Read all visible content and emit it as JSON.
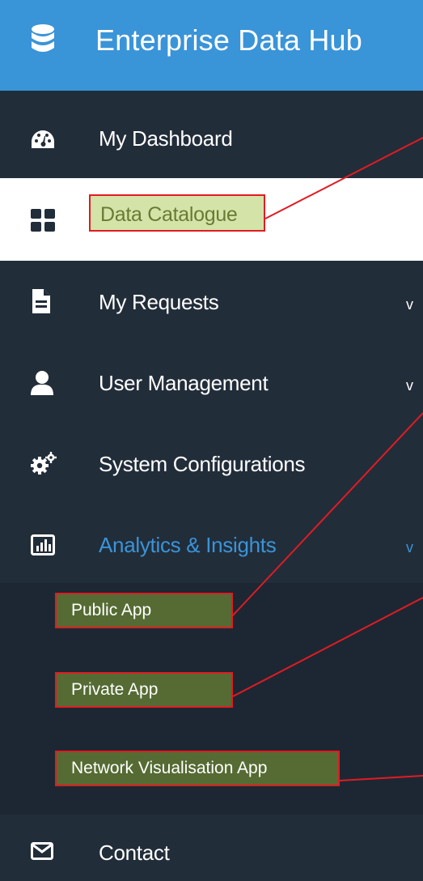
{
  "header": {
    "title": "Enterprise Data Hub",
    "logo_icon": "database-icon"
  },
  "nav": {
    "dashboard": {
      "label": "My Dashboard",
      "icon": "dashboard-icon"
    },
    "catalogue": {
      "label": "Data Catalogue",
      "icon": "grid-icon"
    },
    "requests": {
      "label": "My Requests",
      "icon": "document-icon",
      "chevron": "v"
    },
    "users": {
      "label": "User Management",
      "icon": "user-icon",
      "chevron": "v"
    },
    "config": {
      "label": "System Configurations",
      "icon": "gears-icon"
    },
    "analytics": {
      "label": "Analytics & Insights",
      "icon": "bar-chart-icon",
      "chevron": "v"
    },
    "contact": {
      "label": "Contact",
      "icon": "envelope-icon"
    }
  },
  "submenu": {
    "items": [
      {
        "label": "Public App"
      },
      {
        "label": "Private App"
      },
      {
        "label": "Network Visualisation App"
      }
    ]
  },
  "colors": {
    "header_bg": "#3a94d8",
    "sidebar_bg": "#222d3a",
    "submenu_bg": "#1d2733",
    "highlight_green": "#556b33",
    "highlight_light": "#d4e4a8",
    "annotation_red": "#e01c22"
  }
}
